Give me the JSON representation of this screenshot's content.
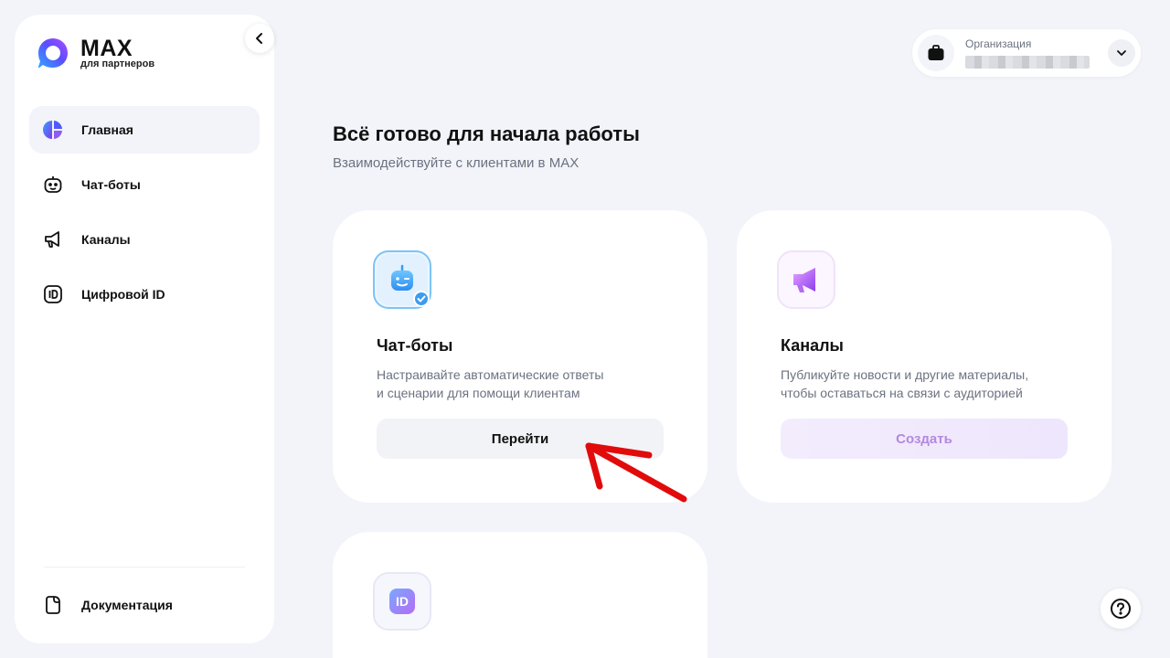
{
  "app": {
    "logo_title": "MAX",
    "logo_subtitle": "для партнеров"
  },
  "sidebar": {
    "items": [
      {
        "label": "Главная",
        "icon": "home-dashboard-icon",
        "active": true
      },
      {
        "label": "Чат-боты",
        "icon": "robot-icon",
        "active": false
      },
      {
        "label": "Каналы",
        "icon": "megaphone-icon",
        "active": false
      },
      {
        "label": "Цифровой ID",
        "icon": "id-card-icon",
        "active": false
      }
    ],
    "docs_label": "Документация"
  },
  "org": {
    "label": "Организация",
    "icon": "briefcase-icon"
  },
  "main": {
    "title": "Всё готово для начала работы",
    "subtitle": "Взаимодействуйте с клиентами в MAX"
  },
  "cards": [
    {
      "title": "Чат-боты",
      "desc_line1": "Настраивайте автоматические ответы",
      "desc_line2": "и сценарии для помощи клиентам",
      "button": "Перейти",
      "icon": "robot-check-icon"
    },
    {
      "title": "Каналы",
      "desc_line1": "Публикуйте новости и другие материалы,",
      "desc_line2": "чтобы оставаться на связи с аудиторией",
      "button": "Создать",
      "icon": "megaphone-icon"
    },
    {
      "icon": "id-badge-icon",
      "icon_text": "ID"
    }
  ],
  "colors": {
    "background": "#f2f4f9",
    "accent_purple": "#8b5cf6",
    "accent_blue": "#3b82f6",
    "annotation_red": "#e10b0b"
  }
}
